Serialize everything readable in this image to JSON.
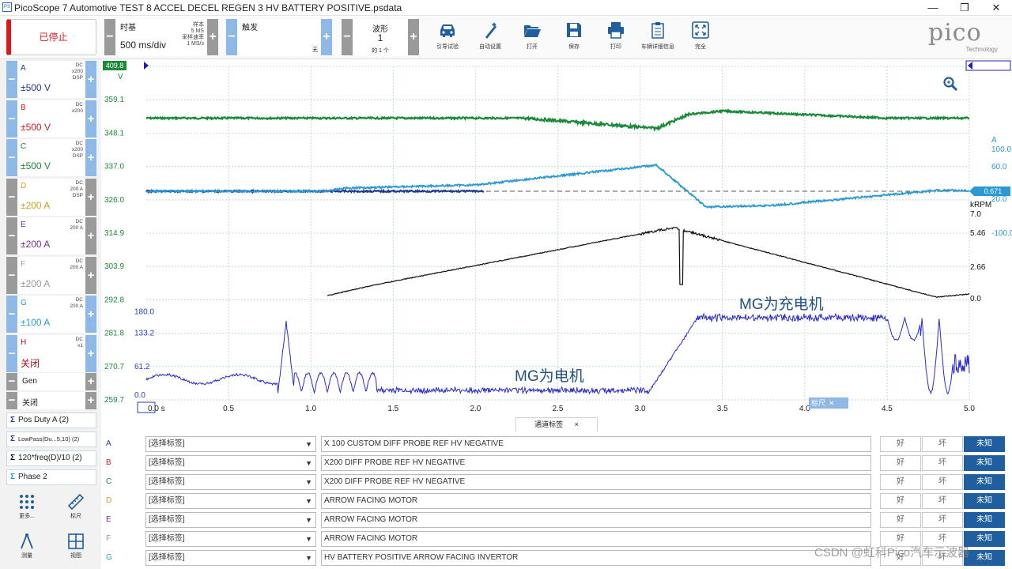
{
  "window": {
    "title": "PicoScope 7 Automotive TEST 8 ACCEL DECEL REGEN 3 HV BATTERY POSITIVE.psdata",
    "app_icon_text": "PS"
  },
  "toolbar": {
    "stop_label": "已停止",
    "timebase_label": "时基",
    "timebase_value": "500 ms/div",
    "sample_label": "样本",
    "sample_value": "5 MS",
    "rate_label": "采样速率",
    "rate_value": "1 MS/s",
    "trigger_label": "触发",
    "trigger_value": "无",
    "waveform_label": "波形",
    "waveform_value": "1",
    "waveform_of": "的 1 个",
    "tools": [
      "引导试验",
      "自动设置",
      "打开",
      "保存",
      "打印",
      "车辆详细信息",
      "完全"
    ],
    "logo_main": "pico",
    "logo_sub": "Technology"
  },
  "channels": [
    {
      "letter": "A",
      "range": "±500 V",
      "s1": "DC",
      "s2": "x200",
      "s3": "DSP",
      "color": "#2a3a8c",
      "grey": false
    },
    {
      "letter": "B",
      "range": "±500 V",
      "s1": "DC",
      "s2": "x200",
      "s3": "",
      "color": "#d71920",
      "grey": false
    },
    {
      "letter": "C",
      "range": "±500 V",
      "s1": "DC",
      "s2": "x200",
      "s3": "DSP",
      "color": "#1b8a3a",
      "grey": false
    },
    {
      "letter": "D",
      "range": "±200 A",
      "s1": "DC",
      "s2": "200 A",
      "s3": "DSP",
      "color": "#c8a020",
      "grey": true
    },
    {
      "letter": "E",
      "range": "±200 A",
      "s1": "DC",
      "s2": "200 A",
      "s3": "",
      "color": "#7a2a8a",
      "grey": true
    },
    {
      "letter": "F",
      "range": "±200 A",
      "s1": "DC",
      "s2": "200 A",
      "s3": "",
      "color": "#9a9a9a",
      "grey": true
    },
    {
      "letter": "G",
      "range": "±100 A",
      "s1": "DC",
      "s2": "200 A",
      "s3": "",
      "color": "#2a9ad0",
      "grey": false
    },
    {
      "letter": "H",
      "range": "关闭",
      "s1": "DC",
      "s2": "x1",
      "s3": "",
      "color": "#b01020",
      "grey": false
    }
  ],
  "gen": {
    "label": "Gen",
    "value": "关闭"
  },
  "math_channels": [
    "Pos Duty A (2)",
    "LowPass(Du...5,10) (2)",
    "120*freq(D)/10 (2)",
    "Phase 2"
  ],
  "bottom_tools": [
    "更多...",
    "标尺",
    "测量",
    "视图"
  ],
  "plot": {
    "left_axis_unit": "V",
    "left_top_marker": "409.8",
    "left_ticks": [
      "359.1",
      "348.1",
      "337.0",
      "326.0",
      "314.9",
      "303.9",
      "292.8",
      "281.8",
      "270.7",
      "259.7"
    ],
    "inner_axis_ticks": [
      "180.0",
      "133.2",
      "61.2",
      "0.0"
    ],
    "right_A_label": "A",
    "right_A_ticks": [
      "100.0",
      "60.0",
      "20.0",
      "-100.0"
    ],
    "right_marker_value": "0.671",
    "right_krpm_label": "kRPM",
    "right_krpm_ticks": [
      "7.0",
      "5.46",
      "2.66",
      "0.0"
    ],
    "x_ticks": [
      "0.0 s",
      "0.5",
      "1.0",
      "1.5",
      "2.0",
      "2.5",
      "3.0",
      "3.5",
      "4.0",
      "4.5",
      "5.0"
    ],
    "annotation_motor": "MG为电机",
    "annotation_generator": "MG为充电机",
    "ruler_tag": "标尺",
    "zoom_icon": "magnifier-icon"
  },
  "labels_panel": {
    "tab_title": "通道标签",
    "rows": [
      {
        "ch": "A",
        "color": "#2a3a8c",
        "select": "[选择标签]",
        "text": "X 100 CUSTOM DIFF PROBE REF HV NEGATIVE"
      },
      {
        "ch": "B",
        "color": "#d71920",
        "select": "[选择标签]",
        "text": "X200 DIFF PROBE REF HV NEGATIVE"
      },
      {
        "ch": "C",
        "color": "#1b8a3a",
        "select": "[选择标签]",
        "text": "X200 DIFF PROBE REF HV NEGATIVE"
      },
      {
        "ch": "D",
        "color": "#c8a020",
        "select": "[选择标签]",
        "text": "ARROW FACING MOTOR"
      },
      {
        "ch": "E",
        "color": "#7a2a8a",
        "select": "[选择标签]",
        "text": "ARROW FACING MOTOR"
      },
      {
        "ch": "F",
        "color": "#9a9a9a",
        "select": "[选择标签]",
        "text": "ARROW FACING MOTOR"
      },
      {
        "ch": "G",
        "color": "#2a9ad0",
        "select": "[选择标签]",
        "text": "HV BATTERY POSITIVE ARROW FACING INVERTOR"
      }
    ],
    "good": "好",
    "bad": "坏",
    "unknown": "未知"
  },
  "watermark": "CSDN @虹科Pico汽车示波器"
}
